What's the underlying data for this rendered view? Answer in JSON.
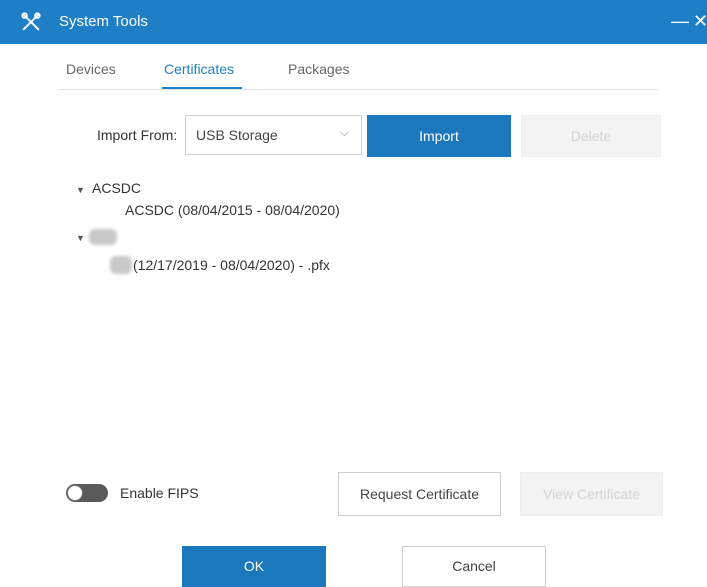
{
  "window": {
    "title": "System Tools",
    "minimize_glyph": "—",
    "close_glyph": "✕",
    "icon": "tools-icon"
  },
  "tabs": [
    {
      "label": "Devices",
      "active": false
    },
    {
      "label": "Certificates",
      "active": true
    },
    {
      "label": "Packages",
      "active": false
    }
  ],
  "import": {
    "label": "Import From:",
    "source_value": "USB Storage",
    "import_button": "Import",
    "delete_button": "Delete"
  },
  "certificates": [
    {
      "group": "ACSDC",
      "item": "ACSDC (08/04/2015 - 08/04/2020)"
    },
    {
      "group": "",
      "item": "(12/17/2019 - 08/04/2020) - .pfx"
    }
  ],
  "fips": {
    "label": "Enable FIPS",
    "enabled": false
  },
  "actions": {
    "request_certificate": "Request Certificate",
    "view_certificate": "View Certificate"
  },
  "footer": {
    "ok": "OK",
    "cancel": "Cancel"
  },
  "colors": {
    "accent": "#1f7fc6",
    "primary_button": "#1c78bd"
  }
}
